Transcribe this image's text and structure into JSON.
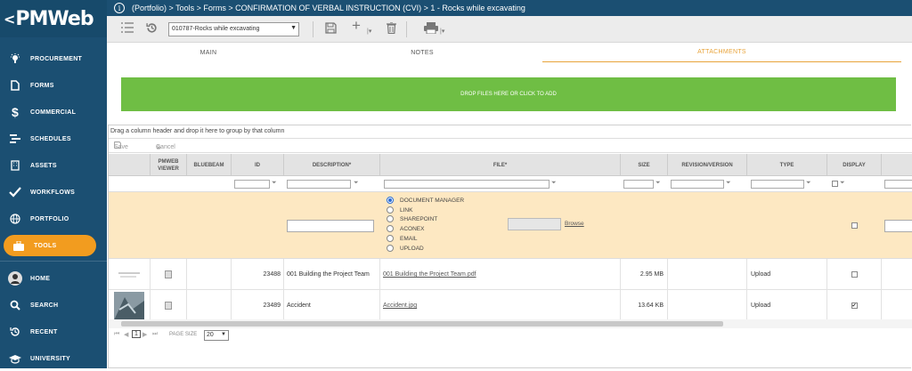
{
  "app": {
    "logo": "PMWeb",
    "logo_prefix": "<"
  },
  "breadcrumb": "(Portfolio) > Tools > Forms > CONFIRMATION OF VERBAL INSTRUCTION (CVI) > 1 - Rocks while excavating",
  "nav": [
    {
      "label": "PROCUREMENT",
      "icon": "lightbulb-icon"
    },
    {
      "label": "FORMS",
      "icon": "document-icon"
    },
    {
      "label": "COMMERCIAL",
      "icon": "dollar-icon"
    },
    {
      "label": "SCHEDULES",
      "icon": "schedule-icon"
    },
    {
      "label": "ASSETS",
      "icon": "building-icon"
    },
    {
      "label": "WORKFLOWS",
      "icon": "check-icon"
    },
    {
      "label": "PORTFOLIO",
      "icon": "globe-icon"
    },
    {
      "label": "TOOLS",
      "icon": "briefcase-icon"
    },
    {
      "label": "HOME",
      "icon": "avatar-icon"
    },
    {
      "label": "SEARCH",
      "icon": "search-icon"
    },
    {
      "label": "RECENT",
      "icon": "history-icon"
    },
    {
      "label": "UNIVERSITY",
      "icon": "graduation-icon"
    }
  ],
  "toolbar": {
    "record_select": "010787-Rocks while excavating"
  },
  "tabs": [
    "MAIN",
    "NOTES",
    "ATTACHMENTS"
  ],
  "dropzone": "DROP FILES HERE OR CLICK TO ADD",
  "grid": {
    "group_hint": "Drag a column header and drop it here to group by that column",
    "save": "Save",
    "cancel": "Cancel",
    "headers": [
      "PMWEB VIEWER",
      "BLUEBEAM",
      "ID",
      "DESCRIPTION*",
      "FILE*",
      "SIZE",
      "REVISION/VERSION",
      "TYPE",
      "DISPLAY"
    ],
    "file_options": [
      "DOCUMENT MANAGER",
      "LINK",
      "SHAREPOINT",
      "ACONEX",
      "EMAIL",
      "UPLOAD"
    ],
    "browse": "Browse",
    "rows": [
      {
        "id": "23488",
        "description": "001 Building the Project Team",
        "file": "001 Building the Project Team.pdf",
        "size": "2.95 MB",
        "revision": "",
        "type": "Upload",
        "display": false
      },
      {
        "id": "23489",
        "description": "Accident",
        "file": "Accident.jpg",
        "size": "13.64 KB",
        "revision": "",
        "type": "Upload",
        "display": true
      }
    ],
    "pager": {
      "current": "1",
      "page_size_label": "PAGE SIZE",
      "page_size": "20"
    }
  }
}
